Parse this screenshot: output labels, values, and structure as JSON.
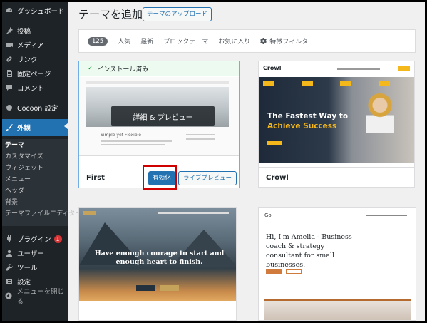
{
  "sidebar": {
    "items": [
      {
        "label": "ダッシュボード",
        "icon": "dashboard-icon"
      },
      {
        "label": "投稿",
        "icon": "pin-icon"
      },
      {
        "label": "メディア",
        "icon": "media-icon"
      },
      {
        "label": "リンク",
        "icon": "link-icon"
      },
      {
        "label": "固定ページ",
        "icon": "page-icon"
      },
      {
        "label": "コメント",
        "icon": "comment-icon"
      },
      {
        "label": "Cocoon 設定",
        "icon": "cocoon-icon"
      },
      {
        "label": "外観",
        "icon": "appearance-icon"
      },
      {
        "label": "プラグイン",
        "icon": "plugin-icon",
        "badge": "1"
      },
      {
        "label": "ユーザー",
        "icon": "user-icon"
      },
      {
        "label": "ツール",
        "icon": "tool-icon"
      },
      {
        "label": "設定",
        "icon": "settings-icon"
      },
      {
        "label": "メニューを閉じる",
        "icon": "collapse-icon"
      }
    ],
    "submenu": [
      "テーマ",
      "カスタマイズ",
      "ウィジェット",
      "メニュー",
      "ヘッダー",
      "背景",
      "テーマファイルエディター"
    ]
  },
  "header": {
    "title": "テーマを追加",
    "upload_button": "テーマのアップロード"
  },
  "filters": {
    "count": "125",
    "links": [
      "人気",
      "最新",
      "ブロックテーマ",
      "お気に入り"
    ],
    "feature_filter": "特徴フィルター"
  },
  "themes": {
    "first": {
      "name": "First",
      "installed": "インストール済み",
      "details": "詳細 & プレビュー",
      "activate": "有効化",
      "live_preview": "ライブプレビュー",
      "shot_heading": "Simple yet Flexible"
    },
    "crowl": {
      "name": "Crowl",
      "logo": "Crowl",
      "headline1": "The Fastest Way to",
      "headline2": "Achieve Success"
    },
    "third": {
      "headline": "Have enough courage to start and enough heart to finish."
    },
    "amelia": {
      "logo": "Go",
      "headline": "Hi, I'm Amelia - Business coach & strategy consultant for small businesses."
    }
  },
  "colors": {
    "accent": "#2271b1",
    "sidebar_bg": "#1d2327",
    "highlight_box": "#d00000",
    "crowl_accent": "#f5b81b"
  }
}
